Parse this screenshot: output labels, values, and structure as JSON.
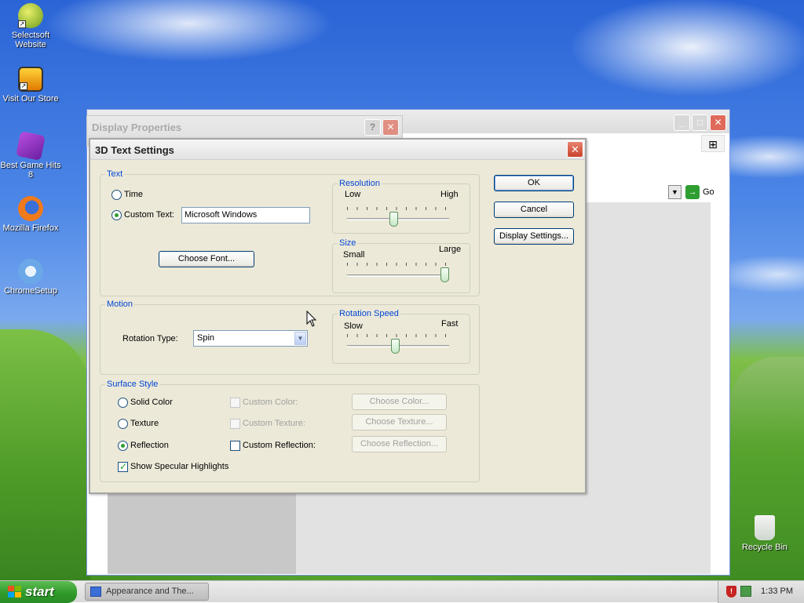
{
  "desktop": {
    "icons": [
      {
        "label": "Selectsoft Website"
      },
      {
        "label": "Visit Our Store"
      },
      {
        "label": "Best Game Hits 8"
      },
      {
        "label": "Mozilla Firefox"
      },
      {
        "label": "ChromeSetup"
      },
      {
        "label": "Recycle Bin"
      }
    ]
  },
  "background_window": {
    "go_label": "Go"
  },
  "display_properties": {
    "title": "Display Properties"
  },
  "dialog": {
    "title": "3D Text Settings",
    "text_group": {
      "label": "Text",
      "time_label": "Time",
      "custom_text_label": "Custom Text:",
      "custom_text_value": "Microsoft Windows",
      "choose_font": "Choose Font...",
      "selected": "custom_text"
    },
    "resolution": {
      "label": "Resolution",
      "low": "Low",
      "high": "High",
      "value": 0.45
    },
    "size": {
      "label": "Size",
      "small": "Small",
      "large": "Large",
      "value": 1.0
    },
    "motion": {
      "label": "Motion",
      "rotation_type_label": "Rotation Type:",
      "rotation_type_value": "Spin"
    },
    "rotation_speed": {
      "label": "Rotation Speed",
      "slow": "Slow",
      "fast": "Fast",
      "value": 0.47
    },
    "surface_style": {
      "label": "Surface Style",
      "solid_color": "Solid Color",
      "texture": "Texture",
      "reflection": "Reflection",
      "custom_color": "Custom Color:",
      "custom_texture": "Custom Texture:",
      "custom_reflection": "Custom Reflection:",
      "choose_color": "Choose Color...",
      "choose_texture": "Choose Texture...",
      "choose_reflection": "Choose Reflection...",
      "show_specular": "Show Specular Highlights",
      "selected": "reflection",
      "specular_checked": true
    },
    "buttons": {
      "ok": "OK",
      "cancel": "Cancel",
      "display_settings": "Display Settings..."
    }
  },
  "taskbar": {
    "start_label": "start",
    "task_item": "Appearance and The...",
    "clock": "1:33 PM"
  }
}
